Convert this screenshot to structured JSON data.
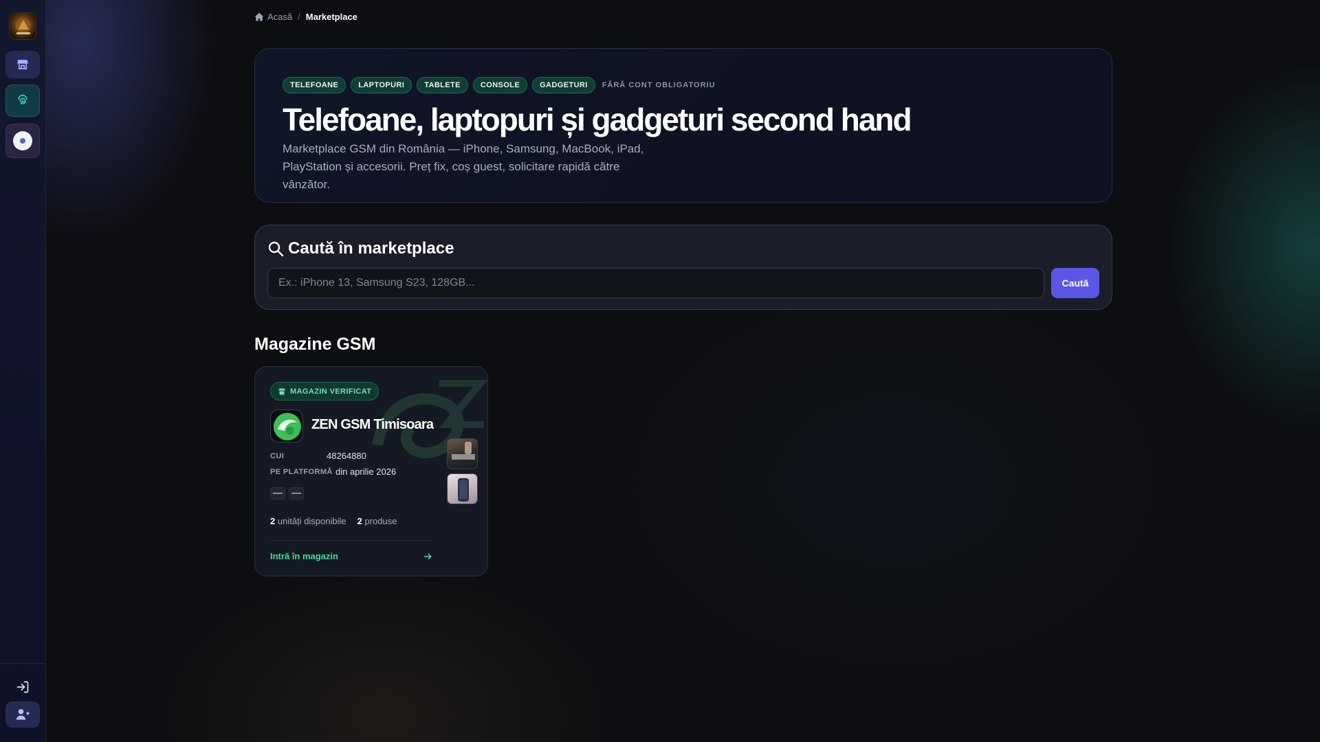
{
  "breadcrumb": {
    "home": "Acasă",
    "separator": "/",
    "current": "Marketplace"
  },
  "hero": {
    "chips": [
      "TELEFOANE",
      "LAPTOPURI",
      "TABLETE",
      "CONSOLE",
      "GADGETURI"
    ],
    "note": "FĂRĂ CONT OBLIGATORIU",
    "title": "Telefoane, laptopuri și gadgeturi second hand",
    "subtitle": "Marketplace GSM din România — iPhone, Samsung, MacBook, iPad, PlayStation și accesorii. Preț fix, coș guest, solicitare rapidă către vânzător."
  },
  "search": {
    "title": "Caută în marketplace",
    "placeholder": "Ex.: iPhone 13, Samsung S23, 128GB...",
    "value": "",
    "button": "Caută"
  },
  "section": {
    "title": "Magazine GSM"
  },
  "store": {
    "badge": "MAGAZIN VERIFICAT",
    "name": "ZEN GSM Timisoara",
    "cui_label": "CUI",
    "cui_value": "48264880",
    "platform_label": "PE PLATFORMĂ",
    "platform_value": "din aprilie 2026",
    "units_count": "2",
    "units_label": "unități disponibile",
    "products_count": "2",
    "products_label": "produse",
    "enter_label": "Intră în magazin",
    "brand_icons": [
      "samsung-logo",
      "scorte-logo"
    ]
  },
  "sidebar": {
    "icons": [
      "app-logo",
      "store-icon",
      "fingerprint-icon",
      "profile-avatar",
      "login-icon",
      "add-user-icon"
    ]
  },
  "colors": {
    "accent": "#5b57e6",
    "green": "#49d9a6",
    "chip_bg": "#103d35"
  }
}
